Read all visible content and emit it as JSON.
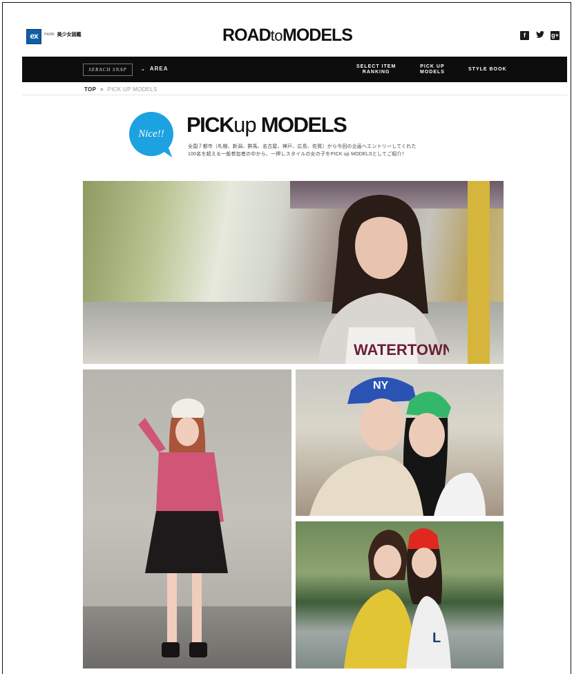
{
  "header": {
    "brand_logo": "ex",
    "brand_sub": "mods",
    "brand_jp": "美少女図鑑",
    "title_main_1": "ROAD",
    "title_to": "to",
    "title_main_2": "MODELS",
    "social": [
      {
        "name": "facebook-icon",
        "glyph": "f"
      },
      {
        "name": "twitter-icon",
        "glyph": "🐦"
      },
      {
        "name": "google-plus-icon",
        "glyph": "g+"
      }
    ]
  },
  "nav": {
    "search_snap": "SERACH SNAP",
    "area": "AREA",
    "select_item_line1": "SELECT ITEM",
    "select_item_line2": "RANKING",
    "pick_up_line1": "PICK UP",
    "pick_up_line2": "MODELS",
    "style_book": "STYLE BOOK"
  },
  "breadcrumb": {
    "top": "TOP",
    "separator": ">",
    "current": "PICK UP MODELS"
  },
  "heading": {
    "badge": "Nice!!",
    "title_pick": "PICK",
    "title_up": "up",
    "title_models": "MODELS",
    "desc_line1": "全国７都市（札幌、新潟、群馬、名古屋、神戸、広島、佐賀）から今回の企画へエントリーしてくれた",
    "desc_line2": "100名を超える一般参加者の中から、一押しスタイルの女の子をPICK up MODELSとしてご紹介！"
  },
  "colors": {
    "navbar": "#0d0d0d",
    "badge": "#1ca2e0",
    "brand_blue": "#0f5fa6"
  }
}
